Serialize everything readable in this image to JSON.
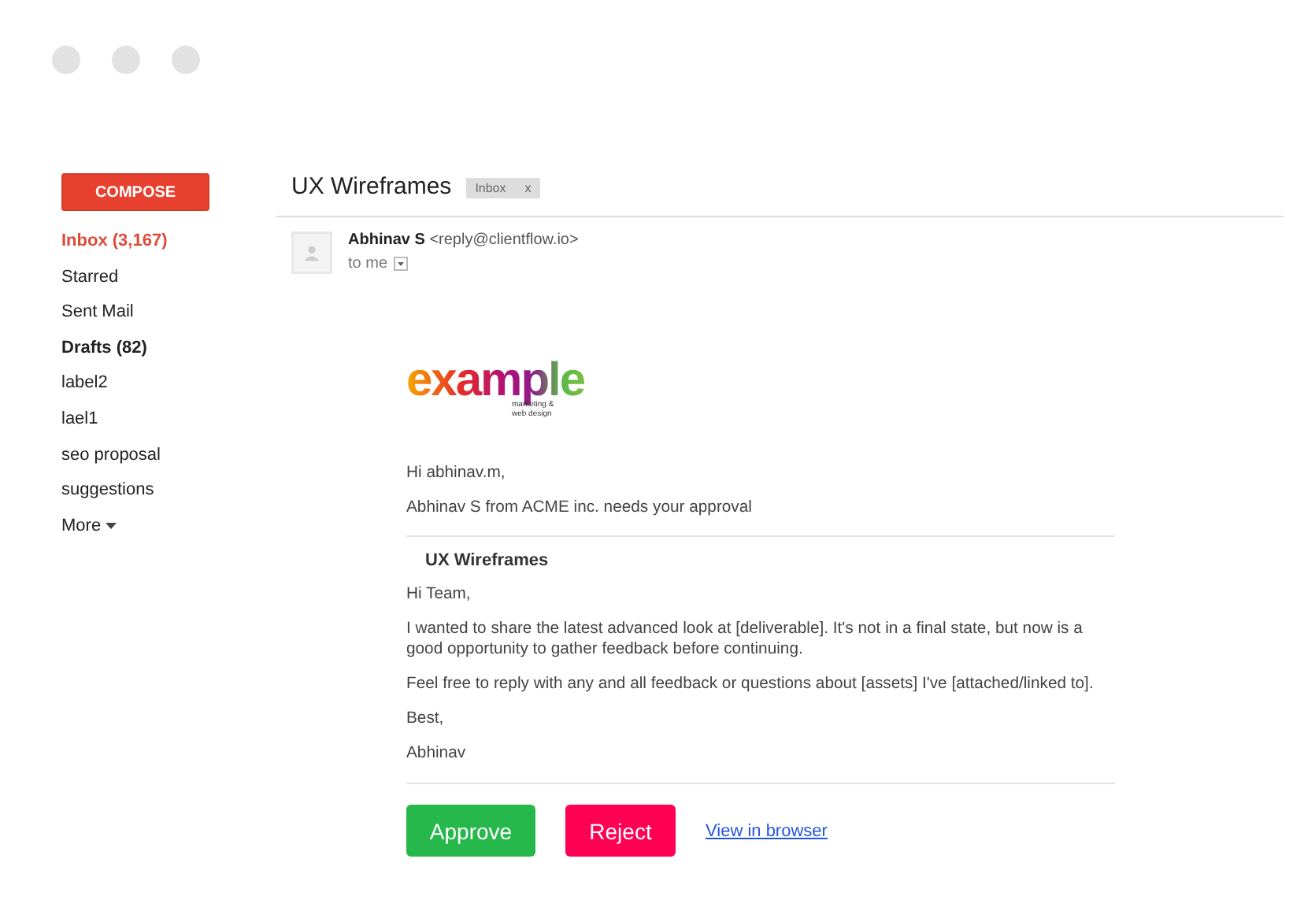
{
  "compose": {
    "label": "COMPOSE"
  },
  "folders": [
    {
      "label": "Inbox (3,167)",
      "selected": true,
      "unread": true
    },
    {
      "label": "Starred",
      "selected": false,
      "unread": false
    },
    {
      "label": "Sent Mail",
      "selected": false,
      "unread": false
    },
    {
      "label": "Drafts (82)",
      "selected": false,
      "unread": true
    },
    {
      "label": "label2",
      "selected": false,
      "unread": false
    },
    {
      "label": "lael1",
      "selected": false,
      "unread": false
    },
    {
      "label": "seo proposal",
      "selected": false,
      "unread": false
    },
    {
      "label": "suggestions",
      "selected": false,
      "unread": false
    }
  ],
  "more": {
    "label": "More"
  },
  "message": {
    "subject": "UX Wireframes",
    "tag": {
      "label": "Inbox",
      "close": "x"
    },
    "sender": {
      "name": "Abhinav S",
      "email": "<reply@clientflow.io>",
      "recipient": "to me"
    },
    "logo": {
      "word": "example",
      "tagline": "marketing & web design"
    },
    "greeting": "Hi abhinav.m,",
    "intro": "Abhinav S from ACME inc. needs your approval",
    "card_title": "UX Wireframes",
    "paragraphs": [
      "Hi Team,",
      "I wanted to share the latest advanced look at [deliverable]. It's not in a final state, but now is a good opportunity to gather feedback before continuing.",
      "Feel free to reply with any and all feedback or questions about [assets] I've [attached/linked to].",
      "Best,",
      "Abhinav"
    ],
    "actions": [
      {
        "kind": "approve",
        "label": "Approve"
      },
      {
        "kind": "reject",
        "label": "Reject"
      },
      {
        "kind": "link",
        "label": "View in browser"
      }
    ]
  }
}
